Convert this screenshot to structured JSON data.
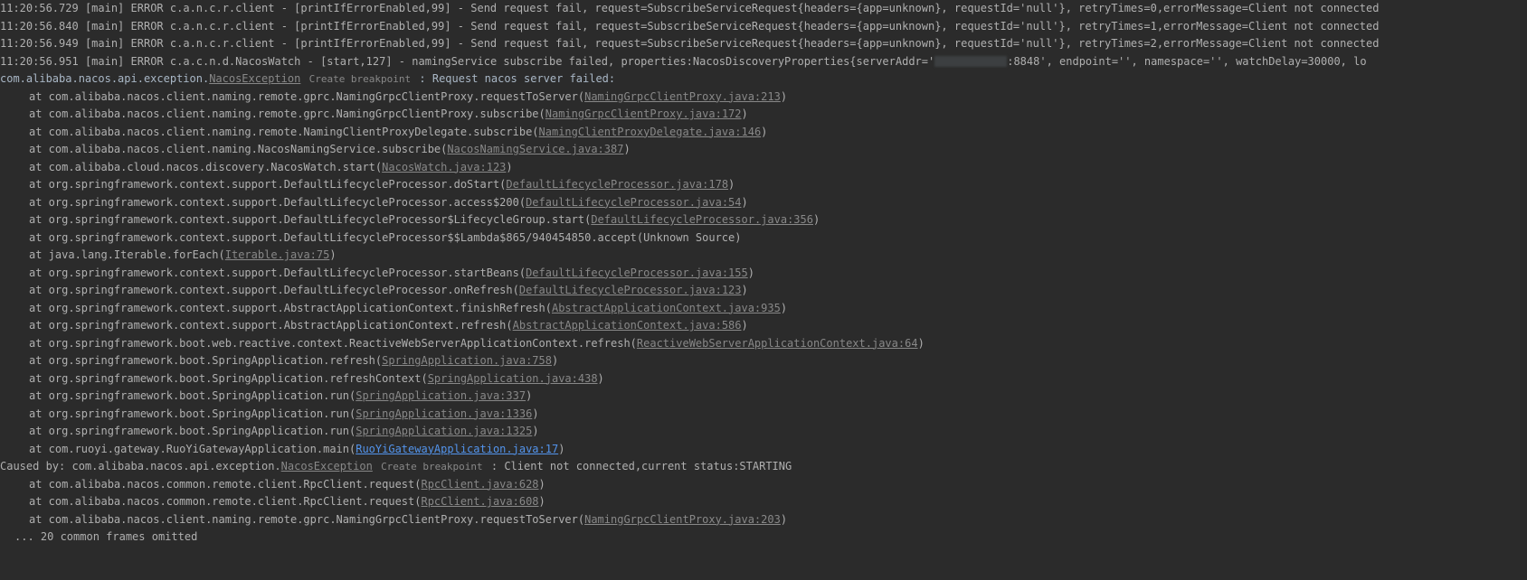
{
  "lines": [
    {
      "type": "log",
      "ts": "11:20:56.729",
      "thread": "[main]",
      "level": "ERROR",
      "logger": "c.a.n.c.r.client",
      "loc": "[printIfErrorEnabled,99]",
      "msg": "Send request fail, request=SubscribeServiceRequest{headers={app=unknown}, requestId='null'}, retryTimes=0,errorMessage=Client not connected"
    },
    {
      "type": "log",
      "ts": "11:20:56.840",
      "thread": "[main]",
      "level": "ERROR",
      "logger": "c.a.n.c.r.client",
      "loc": "[printIfErrorEnabled,99]",
      "msg": "Send request fail, request=SubscribeServiceRequest{headers={app=unknown}, requestId='null'}, retryTimes=1,errorMessage=Client not connected"
    },
    {
      "type": "log",
      "ts": "11:20:56.949",
      "thread": "[main]",
      "level": "ERROR",
      "logger": "c.a.n.c.r.client",
      "loc": "[printIfErrorEnabled,99]",
      "msg": "Send request fail, request=SubscribeServiceRequest{headers={app=unknown}, requestId='null'}, retryTimes=2,errorMessage=Client not connected"
    },
    {
      "type": "log",
      "ts": "11:20:56.951",
      "thread": "[main]",
      "level": "ERROR",
      "logger": "c.a.c.n.d.NacosWatch",
      "loc": "[start,127]",
      "msg_pre": "namingService subscribe failed, properties:NacosDiscoveryProperties{serverAddr='",
      "msg_post": ":8848', endpoint='', namespace='', watchDelay=30000, lo",
      "redacted": true
    },
    {
      "type": "exception_head",
      "pkg": "com.alibaba.nacos.api.exception.",
      "ex_link": "NacosException",
      "breakpoint": "Create breakpoint",
      "tail": " : Request nacos server failed: "
    },
    {
      "type": "at",
      "method": "at com.alibaba.nacos.client.naming.remote.gprc.NamingGrpcClientProxy.requestToServer(",
      "link": "NamingGrpcClientProxy.java:213",
      "tail": ")"
    },
    {
      "type": "at",
      "method": "at com.alibaba.nacos.client.naming.remote.gprc.NamingGrpcClientProxy.subscribe(",
      "link": "NamingGrpcClientProxy.java:172",
      "tail": ")"
    },
    {
      "type": "at",
      "method": "at com.alibaba.nacos.client.naming.remote.NamingClientProxyDelegate.subscribe(",
      "link": "NamingClientProxyDelegate.java:146",
      "tail": ")"
    },
    {
      "type": "at",
      "method": "at com.alibaba.nacos.client.naming.NacosNamingService.subscribe(",
      "link": "NacosNamingService.java:387",
      "tail": ")"
    },
    {
      "type": "at",
      "method": "at com.alibaba.cloud.nacos.discovery.NacosWatch.start(",
      "link": "NacosWatch.java:123",
      "tail": ")"
    },
    {
      "type": "at",
      "method": "at org.springframework.context.support.DefaultLifecycleProcessor.doStart(",
      "link": "DefaultLifecycleProcessor.java:178",
      "tail": ")"
    },
    {
      "type": "at",
      "method": "at org.springframework.context.support.DefaultLifecycleProcessor.access$200(",
      "link": "DefaultLifecycleProcessor.java:54",
      "tail": ")"
    },
    {
      "type": "at",
      "method": "at org.springframework.context.support.DefaultLifecycleProcessor$LifecycleGroup.start(",
      "link": "DefaultLifecycleProcessor.java:356",
      "tail": ")"
    },
    {
      "type": "at_plain",
      "text": "at org.springframework.context.support.DefaultLifecycleProcessor$$Lambda$865/940454850.accept(Unknown Source)"
    },
    {
      "type": "at",
      "method": "at java.lang.Iterable.forEach(",
      "link": "Iterable.java:75",
      "tail": ")"
    },
    {
      "type": "at",
      "method": "at org.springframework.context.support.DefaultLifecycleProcessor.startBeans(",
      "link": "DefaultLifecycleProcessor.java:155",
      "tail": ")"
    },
    {
      "type": "at",
      "method": "at org.springframework.context.support.DefaultLifecycleProcessor.onRefresh(",
      "link": "DefaultLifecycleProcessor.java:123",
      "tail": ")"
    },
    {
      "type": "at",
      "method": "at org.springframework.context.support.AbstractApplicationContext.finishRefresh(",
      "link": "AbstractApplicationContext.java:935",
      "tail": ")"
    },
    {
      "type": "at",
      "method": "at org.springframework.context.support.AbstractApplicationContext.refresh(",
      "link": "AbstractApplicationContext.java:586",
      "tail": ")"
    },
    {
      "type": "at",
      "method": "at org.springframework.boot.web.reactive.context.ReactiveWebServerApplicationContext.refresh(",
      "link": "ReactiveWebServerApplicationContext.java:64",
      "tail": ")"
    },
    {
      "type": "at",
      "method": "at org.springframework.boot.SpringApplication.refresh(",
      "link": "SpringApplication.java:758",
      "tail": ")"
    },
    {
      "type": "at",
      "method": "at org.springframework.boot.SpringApplication.refreshContext(",
      "link": "SpringApplication.java:438",
      "tail": ")"
    },
    {
      "type": "at",
      "method": "at org.springframework.boot.SpringApplication.run(",
      "link": "SpringApplication.java:337",
      "tail": ")"
    },
    {
      "type": "at",
      "method": "at org.springframework.boot.SpringApplication.run(",
      "link": "SpringApplication.java:1336",
      "tail": ")"
    },
    {
      "type": "at",
      "method": "at org.springframework.boot.SpringApplication.run(",
      "link": "SpringApplication.java:1325",
      "tail": ")"
    },
    {
      "type": "at",
      "method": "at com.ruoyi.gateway.RuoYiGatewayApplication.main(",
      "link": "RuoYiGatewayApplication.java:17",
      "tail": ")",
      "blue": true
    },
    {
      "type": "caused",
      "prefix": "Caused by: com.alibaba.nacos.api.exception.",
      "ex_link": "NacosException",
      "breakpoint": "Create breakpoint",
      "tail": " : Client not connected,current status:STARTING"
    },
    {
      "type": "at",
      "method": "at com.alibaba.nacos.common.remote.client.RpcClient.request(",
      "link": "RpcClient.java:628",
      "tail": ")"
    },
    {
      "type": "at",
      "method": "at com.alibaba.nacos.common.remote.client.RpcClient.request(",
      "link": "RpcClient.java:608",
      "tail": ")"
    },
    {
      "type": "at",
      "method": "at com.alibaba.nacos.client.naming.remote.gprc.NamingGrpcClientProxy.requestToServer(",
      "link": "NamingGrpcClientProxy.java:203",
      "tail": ")"
    },
    {
      "type": "omitted",
      "text": "... 20 common frames omitted"
    }
  ]
}
